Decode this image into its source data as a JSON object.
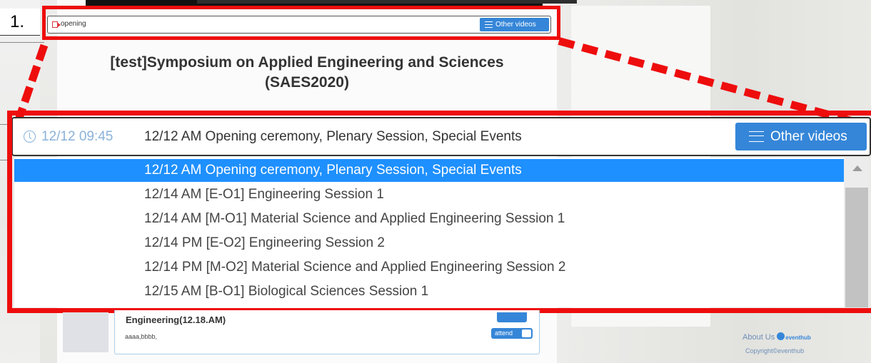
{
  "step": {
    "number": "1."
  },
  "player_bar_small": {
    "video_title": "opening",
    "other_videos_label": "Other videos"
  },
  "event": {
    "title_line1": "[test]Symposium on Applied Engineering and Sciences",
    "title_line2": "(SAES2020)"
  },
  "player_bar_zoomed": {
    "time": "12/12 09:45",
    "current_session": "12/12 AM Opening ceremony, Plenary Session, Special Events",
    "other_videos_label": "Other videos"
  },
  "session_dropdown": {
    "items": [
      {
        "label": "12/12 AM Opening ceremony, Plenary Session, Special Events"
      },
      {
        "label": "12/14 AM [E-O1] Engineering Session 1"
      },
      {
        "label": "12/14 AM [M-O1] Material Science and Applied Engineering Session 1"
      },
      {
        "label": "12/14 PM [E-O2] Engineering Session  2"
      },
      {
        "label": "12/14 PM [M-O2] Material Science and Applied Engineering Session 2"
      },
      {
        "label": "12/15 AM [B-O1] Biological Sciences Session 1"
      }
    ],
    "selected_index": 0
  },
  "lower_card": {
    "title": "Engineering(12.18.AM)",
    "authors": "aaaa,bbbb,",
    "attend_label": "attend"
  },
  "footer": {
    "about": "About Us",
    "brand": "eventhub",
    "copyright": "Copyright©eventhub"
  },
  "colors": {
    "highlight_red": "#ee0d0d",
    "accent_blue": "#3586d8",
    "selected_blue": "#1e90ff"
  },
  "icons": {
    "video": "video-camera-icon",
    "list": "list-icon",
    "clock": "clock-icon",
    "scroll_up": "scroll-up-arrow-icon"
  }
}
